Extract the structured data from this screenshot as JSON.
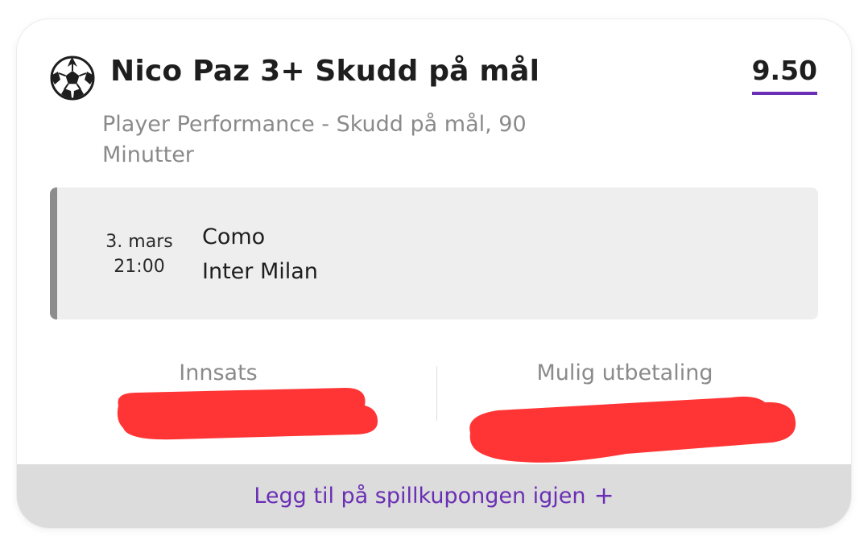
{
  "bet": {
    "title": "Nico Paz 3+ Skudd på mål",
    "odds": "9.50",
    "subtitle": "Player Performance - Skudd på mål, 90 Minutter",
    "sport_icon": "soccer-ball-icon"
  },
  "event": {
    "date": "3. mars",
    "time": "21:00",
    "home_team": "Como",
    "away_team": "Inter Milan"
  },
  "stats": {
    "stake_label": "Innsats",
    "payout_label": "Mulig utbetaling"
  },
  "footer": {
    "add_again_label": "Legg til på spillkupongen igjen",
    "plus_symbol": "+"
  },
  "colors": {
    "accent": "#6a2fb4",
    "redaction": "#ff3535",
    "event_border": "#8c8c8c"
  }
}
